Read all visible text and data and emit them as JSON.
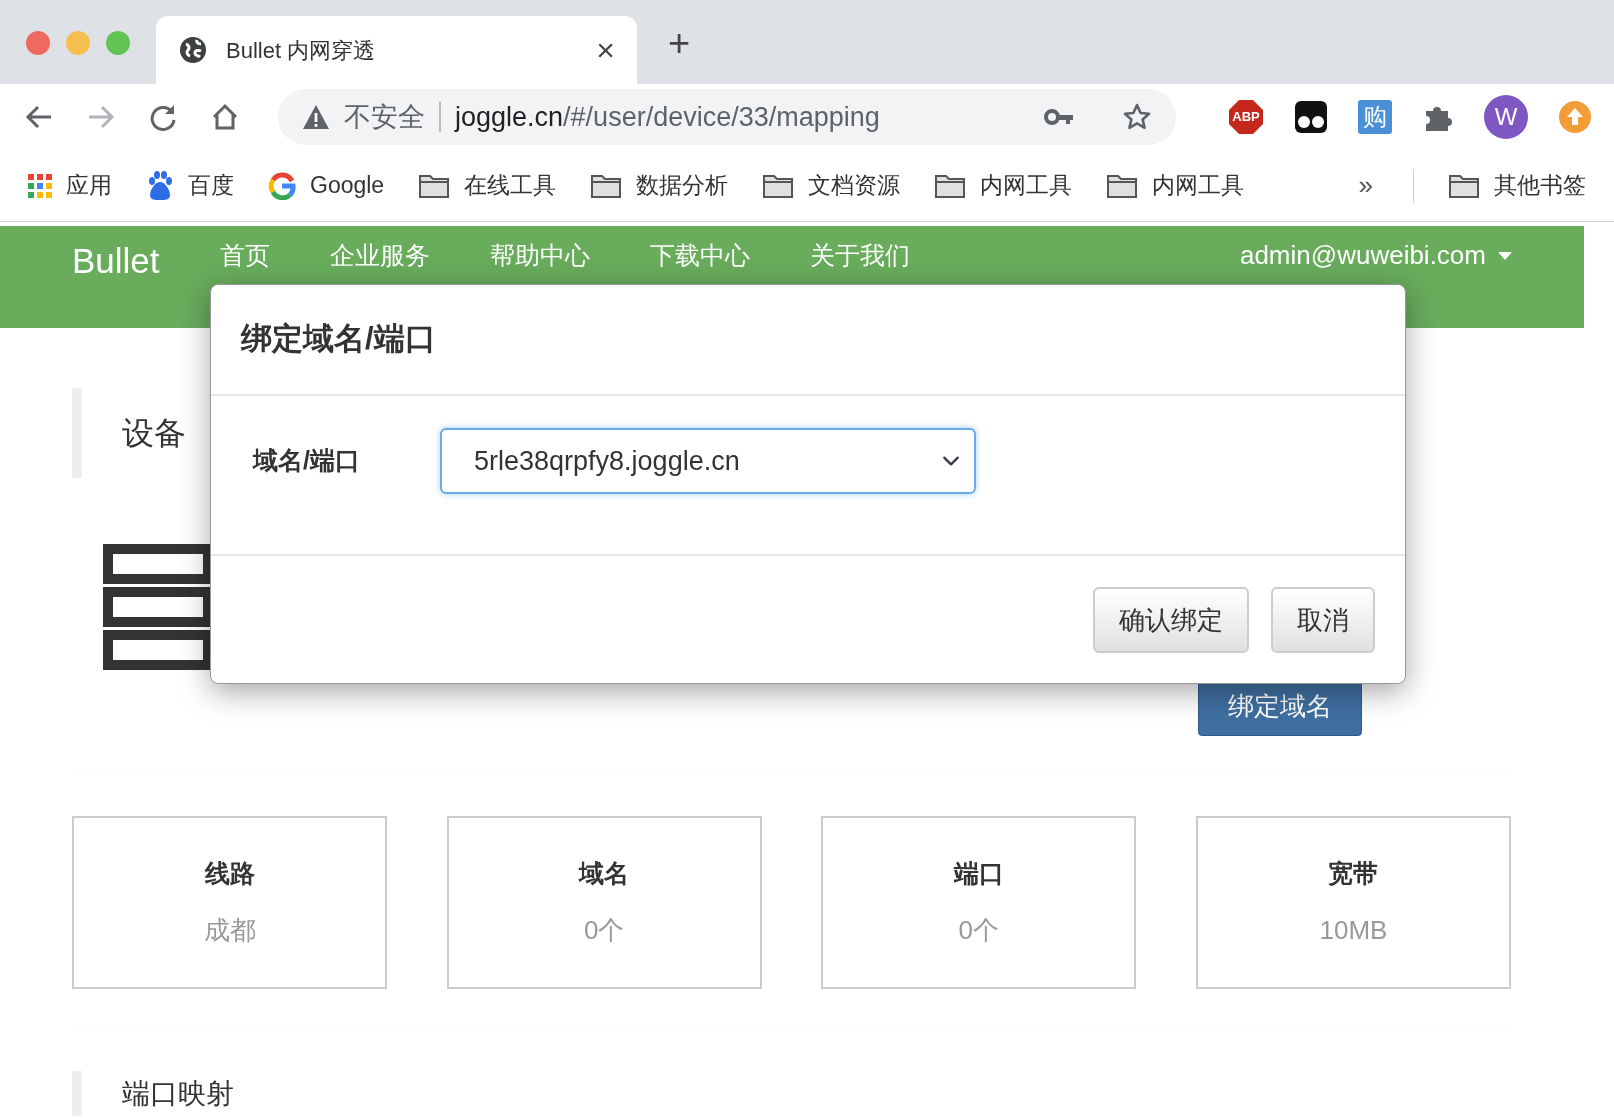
{
  "browser": {
    "tab": {
      "title": "Bullet 内网穿透",
      "close": "×",
      "new_tab": "+"
    },
    "address": {
      "security": "不安全",
      "host": "joggle.cn",
      "path": "/#/user/device/33/mapping"
    },
    "extensions": [
      {
        "kind": "abp",
        "label": "ABP"
      },
      {
        "kind": "glasses"
      },
      {
        "kind": "shop",
        "label": "购"
      },
      {
        "kind": "puzzle"
      },
      {
        "kind": "avatar",
        "label": "W"
      },
      {
        "kind": "update"
      }
    ],
    "bookmarks": [
      {
        "kind": "apps",
        "label": "应用"
      },
      {
        "kind": "baidu",
        "label": "百度"
      },
      {
        "kind": "google",
        "label": "Google"
      },
      {
        "kind": "folder",
        "label": "在线工具"
      },
      {
        "kind": "folder",
        "label": "数据分析"
      },
      {
        "kind": "folder",
        "label": "文档资源"
      },
      {
        "kind": "folder",
        "label": "内网工具"
      },
      {
        "kind": "folder",
        "label": "内网工具"
      }
    ],
    "overflow": "»",
    "other_bookmarks": "其他书签"
  },
  "navbar": {
    "brand": "Bullet",
    "links": [
      "首页",
      "企业服务",
      "帮助中心",
      "下载中心",
      "关于我们"
    ],
    "user": "admin@wuweibi.com"
  },
  "page": {
    "section_title": "设备",
    "bind_button": "绑定域名",
    "stats": [
      {
        "label": "线路",
        "value": "成都"
      },
      {
        "label": "域名",
        "value": "0个"
      },
      {
        "label": "端口",
        "value": "0个"
      },
      {
        "label": "宽带",
        "value": "10MB"
      }
    ],
    "next_section": "端口映射"
  },
  "modal": {
    "title": "绑定域名/端口",
    "field_label": "域名/端口",
    "select_value": "5rle38qrpfy8.joggle.cn",
    "buttons": [
      "确认绑定",
      "取消"
    ]
  }
}
